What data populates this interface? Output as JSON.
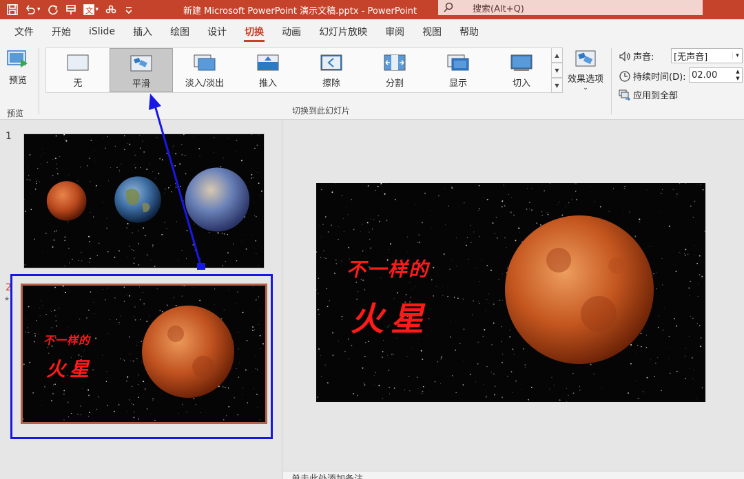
{
  "titlebar": {
    "document_title": "新建 Microsoft PowerPoint 演示文稿.pptx  -  PowerPoint",
    "search_placeholder": "搜索(Alt+Q)",
    "icons": [
      "save-icon",
      "undo-icon",
      "redo-icon",
      "pin-icon",
      "translate-icon",
      "more-icon",
      "customize-icon"
    ],
    "background_color": "#c4432a"
  },
  "menu": {
    "tabs": [
      "文件",
      "开始",
      "iSlide",
      "插入",
      "绘图",
      "设计",
      "切换",
      "动画",
      "幻灯片放映",
      "审阅",
      "视图",
      "帮助"
    ],
    "active_index": 6
  },
  "ribbon": {
    "preview": {
      "button_label": "预览",
      "group_label": "预览"
    },
    "transitions": {
      "group_label": "切换到此幻灯片",
      "items": [
        {
          "label": "无",
          "icon": "none-transition-icon"
        },
        {
          "label": "平滑",
          "icon": "morph-transition-icon"
        },
        {
          "label": "淡入/淡出",
          "icon": "fade-transition-icon"
        },
        {
          "label": "推入",
          "icon": "push-transition-icon"
        },
        {
          "label": "擦除",
          "icon": "wipe-transition-icon"
        },
        {
          "label": "分割",
          "icon": "split-transition-icon"
        },
        {
          "label": "显示",
          "icon": "reveal-transition-icon"
        },
        {
          "label": "切入",
          "icon": "cut-transition-icon"
        }
      ],
      "selected_index": 1
    },
    "effects": {
      "label": "效果选项"
    },
    "timing": {
      "sound_label": "声音:",
      "sound_value": "[无声音]",
      "duration_label": "持续时间(D):",
      "duration_value": "02.00",
      "apply_all_label": "应用到全部"
    }
  },
  "slides_panel": {
    "slides": [
      {
        "number": "1"
      },
      {
        "number": "2",
        "title_line1": "不一样的",
        "title_line2": "火星"
      }
    ],
    "selected_index": 1
  },
  "main_slide": {
    "title_line1": "不一样的",
    "title_line2": "火星",
    "title_color": "#ff1a1a"
  },
  "notes": {
    "placeholder": "单击此处添加备注"
  },
  "annotation": {
    "color": "#1717e6"
  }
}
